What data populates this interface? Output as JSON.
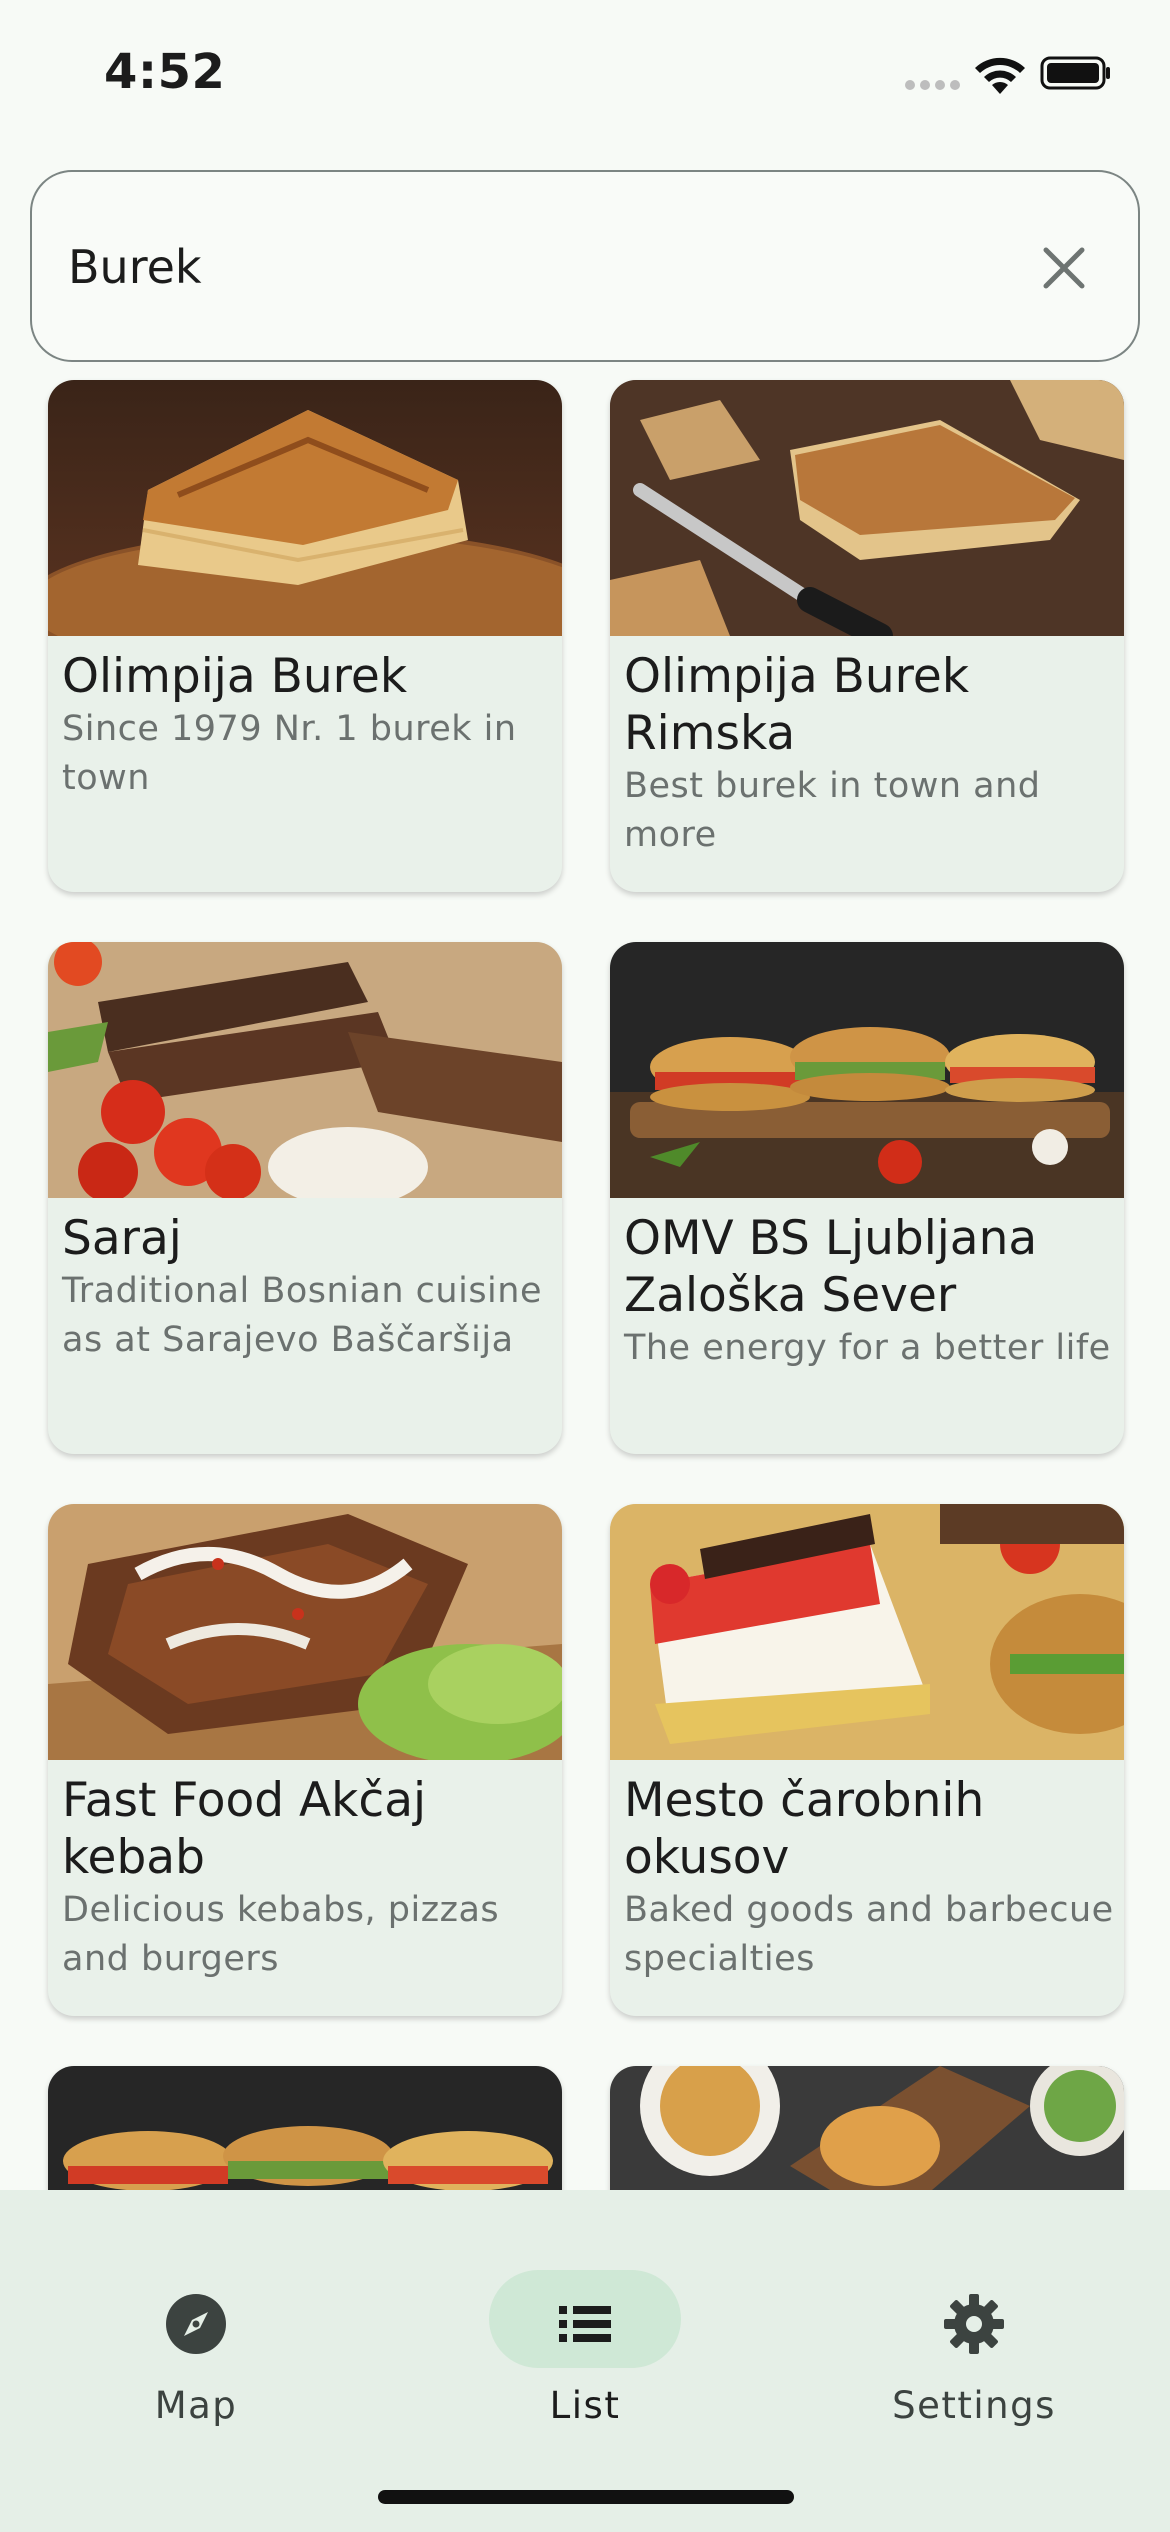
{
  "status_bar": {
    "time": "4:52",
    "signal_icon": "cellular-signal-icon",
    "wifi_icon": "wifi-icon",
    "battery_icon": "battery-full-icon"
  },
  "search": {
    "value": "Burek",
    "placeholder": "Search",
    "clear_icon": "close-icon"
  },
  "restaurants": [
    {
      "name": "Olimpija Burek",
      "description": "Since 1979 Nr. 1 burek in town",
      "image": "burek-slice-photo"
    },
    {
      "name": "Olimpija Burek Rimska",
      "description": "Best burek in town and more",
      "image": "burek-knife-photo"
    },
    {
      "name": "Saraj",
      "description": "Traditional Bosnian cuisine as at Sarajevo Baščaršija",
      "image": "grilled-meat-photo"
    },
    {
      "name": "OMV BS Ljubljana Zaloška Sever",
      "description": "The energy for a better life",
      "image": "sandwiches-photo"
    },
    {
      "name": "Fast Food Akčaj kebab",
      "description": "Delicious kebabs, pizzas and burgers",
      "image": "kebab-photo"
    },
    {
      "name": "Mesto čarobnih okusov",
      "description": "Baked goods and barbecue specialties",
      "image": "cake-burger-photo"
    },
    {
      "name": "",
      "description": "",
      "image": "sandwiches-photo"
    },
    {
      "name": "",
      "description": "",
      "image": "burger-plates-photo"
    }
  ],
  "bottom_nav": {
    "items": [
      {
        "label": "Map",
        "icon": "compass-icon",
        "active": false
      },
      {
        "label": "List",
        "icon": "list-icon",
        "active": true
      },
      {
        "label": "Settings",
        "icon": "gear-icon",
        "active": false
      }
    ]
  },
  "colors": {
    "background": "#f7faf6",
    "card": "#e9f1ea",
    "nav_background": "#e5efe7",
    "active_pill": "#cfe8d6",
    "title_text": "#1c1c1c",
    "secondary_text": "#6b716f"
  }
}
